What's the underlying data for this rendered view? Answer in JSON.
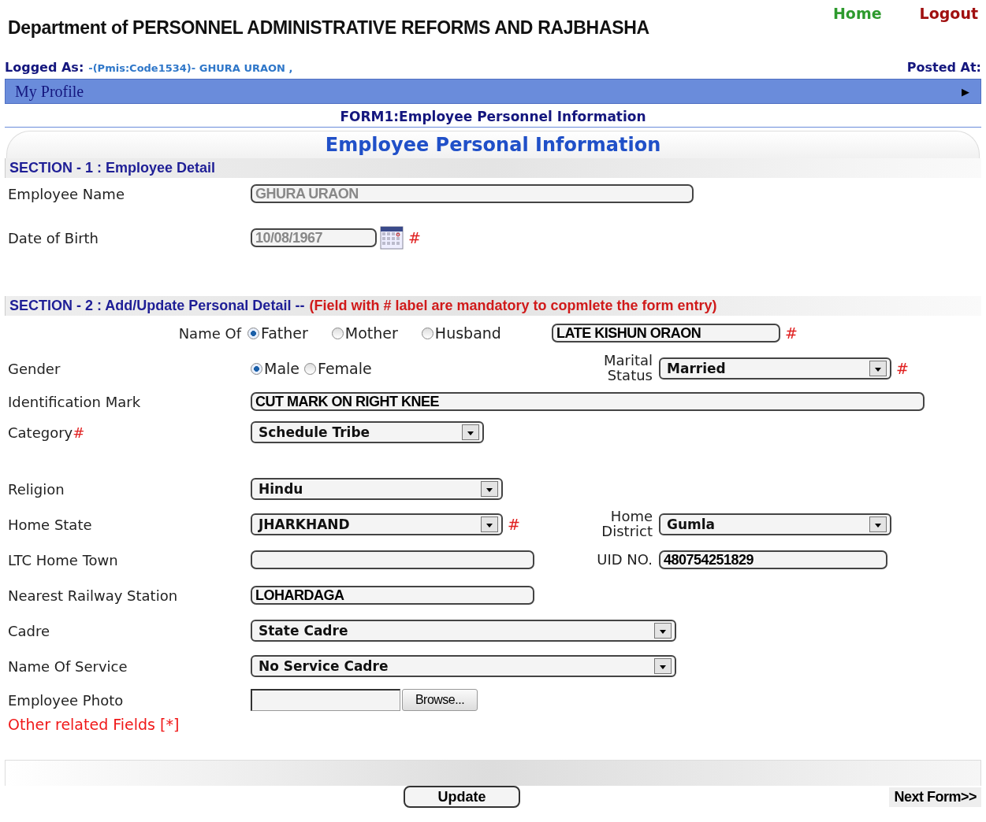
{
  "header": {
    "title": "Department of PERSONNEL ADMINISTRATIVE REFORMS AND RAJBHASHA",
    "links": [
      {
        "label": "Home",
        "kind": "home"
      },
      {
        "label": "Logout",
        "kind": "logout"
      }
    ]
  },
  "user_bar": {
    "logged_label": "Logged As:",
    "logged_value": "-(Pmis:Code1534)- GHURA URAON ,",
    "posted_label": "Posted At:"
  },
  "menu_bar": {
    "label": "My Profile",
    "arrow": "▶"
  },
  "form_title": "FORM1:Employee Personnel Information",
  "panel_title": "Employee Personal Information",
  "section_1": {
    "heading": "SECTION - 1 : Employee Detail",
    "fields": [
      {
        "label": "Employee Name",
        "kind": "text",
        "value": "GHURA URAON",
        "disabled": true
      },
      {
        "label": "Date of Birth",
        "kind": "date",
        "value": "10/08/1967",
        "mark": "#",
        "disabled": true
      }
    ]
  },
  "section_2": {
    "heading": "SECTION - 2 : Add/Update Personal Detail --",
    "note": "(Field with # label are mandatory to copmlete the form entry)",
    "name_of": {
      "label": "Name Of",
      "options": [
        {
          "label": "Father",
          "selected": true
        },
        {
          "label": "Mother",
          "selected": false
        },
        {
          "label": "Husband",
          "selected": false
        }
      ],
      "value": "LATE KISHUN ORAON",
      "mark": "#"
    },
    "rows": [
      {
        "label": "Gender",
        "field": {
          "kind": "radio",
          "options": [
            {
              "label": "Male",
              "selected": true
            },
            {
              "label": "Female",
              "selected": false
            }
          ]
        },
        "right": {
          "label": "Marital Status",
          "field": {
            "kind": "select",
            "value": "Married",
            "mark": "#"
          }
        }
      },
      {
        "label": "Identification  Mark",
        "field": {
          "kind": "text",
          "value": "CUT MARK ON RIGHT KNEE"
        }
      },
      {
        "label": "Category",
        "label_mark": "#",
        "field": {
          "kind": "select",
          "value": "Schedule Tribe"
        }
      },
      {
        "label": "Religion",
        "field": {
          "kind": "select",
          "value": "Hindu"
        }
      },
      {
        "label": "Home State",
        "field": {
          "kind": "select",
          "value": "JHARKHAND",
          "mark": "#"
        },
        "right": {
          "label": "Home District",
          "field": {
            "kind": "select",
            "value": "Gumla"
          }
        }
      },
      {
        "label": "LTC Home Town",
        "field": {
          "kind": "text"
        },
        "right": {
          "label": "UID NO.",
          "field": {
            "kind": "text",
            "value": "480754251829"
          }
        }
      },
      {
        "label": "Nearest Railway Station",
        "field": {
          "kind": "text",
          "value": "LOHARDAGA"
        }
      },
      {
        "label": "Cadre",
        "field": {
          "kind": "select",
          "value": "State Cadre"
        }
      },
      {
        "label": "Name Of Service",
        "field": {
          "kind": "select",
          "value": "No Service Cadre"
        }
      },
      {
        "label": "Employee Photo",
        "field": {
          "kind": "file",
          "button": "Browse..."
        }
      }
    ],
    "other_fields_link": "Other related Fields [*]"
  },
  "buttons": [
    {
      "label": "Update",
      "kind": "update"
    },
    {
      "label": "Next Form>>",
      "kind": "next"
    }
  ]
}
